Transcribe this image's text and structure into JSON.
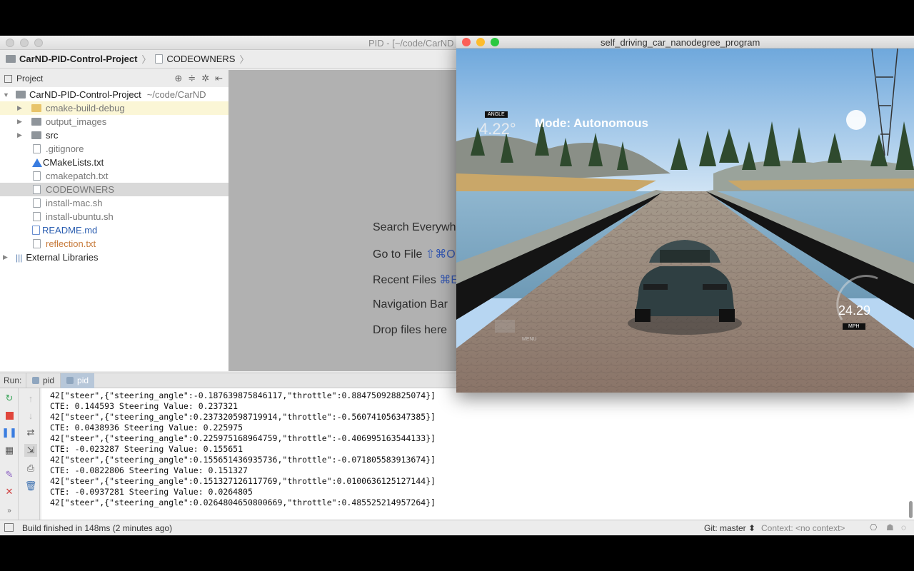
{
  "ide": {
    "title": "PID - [~/code/CarND",
    "breadcrumb": [
      "CarND-PID-Control-Project",
      "CODEOWNERS"
    ],
    "project_header": "Project",
    "tree": {
      "root_name": "CarND-PID-Control-Project",
      "root_path": "~/code/CarND",
      "items": [
        {
          "label": "cmake-build-debug",
          "type": "folder"
        },
        {
          "label": "output_images",
          "type": "folder"
        },
        {
          "label": "src",
          "type": "folder"
        },
        {
          "label": ".gitignore",
          "type": "file"
        },
        {
          "label": "CMakeLists.txt",
          "type": "cmake"
        },
        {
          "label": "cmakepatch.txt",
          "type": "file"
        },
        {
          "label": "CODEOWNERS",
          "type": "file",
          "selected": true
        },
        {
          "label": "install-mac.sh",
          "type": "file"
        },
        {
          "label": "install-ubuntu.sh",
          "type": "file"
        },
        {
          "label": "README.md",
          "type": "md"
        },
        {
          "label": "reflection.txt",
          "type": "file"
        }
      ],
      "external": "External Libraries"
    },
    "editor_hints": [
      {
        "text": "Search Everywh",
        "key": ""
      },
      {
        "text": "Go to File ",
        "key": "⇧⌘O"
      },
      {
        "text": "Recent Files ",
        "key": "⌘E"
      },
      {
        "text": "Navigation Bar",
        "key": ""
      },
      {
        "text": "Drop files here",
        "key": ""
      }
    ],
    "run": {
      "label": "Run:",
      "tabs": [
        "pid",
        "pid"
      ]
    },
    "console_lines": [
      "42[\"steer\",{\"steering_angle\":-0.187639875846117,\"throttle\":0.884750928825074}]",
      "CTE: 0.144593 Steering Value: 0.237321",
      "42[\"steer\",{\"steering_angle\":0.237320598719914,\"throttle\":-0.560741056347385}]",
      "CTE: 0.0438936 Steering Value: 0.225975",
      "42[\"steer\",{\"steering_angle\":0.225975168964759,\"throttle\":-0.406995163544133}]",
      "CTE: -0.023287 Steering Value: 0.155651",
      "42[\"steer\",{\"steering_angle\":0.155651436935736,\"throttle\":-0.071805583913674}]",
      "CTE: -0.0822806 Steering Value: 0.151327",
      "42[\"steer\",{\"steering_angle\":0.151327126117769,\"throttle\":0.0100636125127144}]",
      "CTE: -0.0937281 Steering Value: 0.0264805",
      "42[\"steer\",{\"steering_angle\":0.0264804650800669,\"throttle\":0.485525214957264}]"
    ],
    "status": {
      "message": "Build finished in 148ms (2 minutes ago)",
      "git": "Git: master ⬍",
      "context": "Context: <no context>"
    }
  },
  "sim": {
    "title": "self_driving_car_nanodegree_program",
    "angle_label": "ANGLE",
    "angle_value": "4.22°",
    "mode": "Mode: Autonomous",
    "speed": "24.29",
    "speed_unit": "MPH",
    "menu_label": "MENU"
  },
  "colors": {
    "close": "#fc5f57",
    "minimize": "#fdbc2e",
    "maximize": "#2ac840",
    "selection": "#d9d9d9",
    "run_tab_active": "#b7c7d9"
  }
}
